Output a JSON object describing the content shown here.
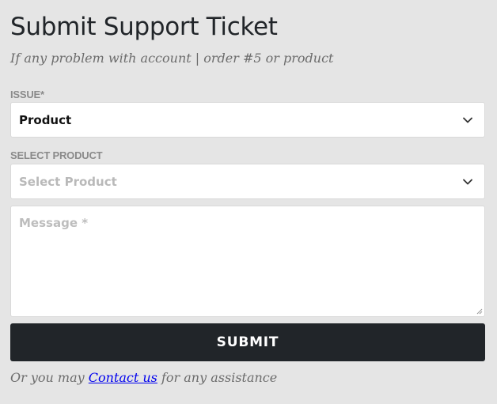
{
  "form": {
    "title": "Submit Support Ticket",
    "subtitle": "If any problem with account | order #5 or product",
    "issue": {
      "label": "ISSUE*",
      "selected": "Product",
      "icon": "chevron-down-icon"
    },
    "product": {
      "label": "SELECT PRODUCT",
      "placeholder": "Select Product",
      "icon": "chevron-down-icon"
    },
    "message": {
      "placeholder": "Message *"
    },
    "submit_label": "SUBMIT",
    "footer": {
      "prefix": "Or you may ",
      "link_text": "Contact us",
      "suffix": " for any assistance"
    }
  },
  "colors": {
    "background": "#e5e5e5",
    "button": "#212529",
    "link": "#0000ee",
    "muted_text": "#6c6c6c"
  }
}
